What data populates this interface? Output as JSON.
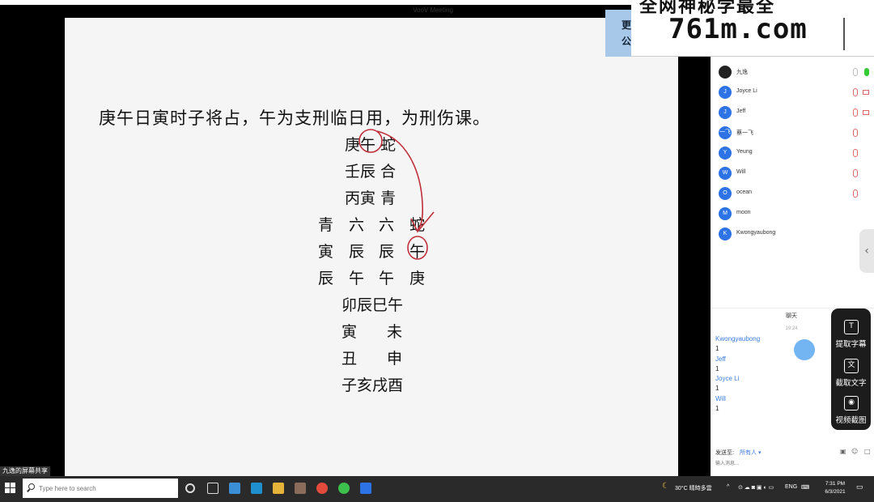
{
  "window": {
    "title": "VooV Meeting"
  },
  "slide": {
    "title": "庚午日寅时子将占，午为支刑临日用，为刑伤课。",
    "stem_rows": [
      "庚午 蛇",
      "壬辰 合",
      "丙寅 青"
    ],
    "grid": [
      [
        "青",
        "六",
        "六",
        "蛇"
      ],
      [
        "寅",
        "辰",
        "辰",
        "午"
      ],
      [
        "辰",
        "午",
        "午",
        "庚"
      ]
    ],
    "heaven_plate": {
      "top": "卯辰巳午",
      "row2_left": "寅",
      "row2_right": "未",
      "row3_left": "丑",
      "row3_right": "申",
      "bottom": "子亥戌酉"
    }
  },
  "watermark": {
    "top": "全网神秘学最全",
    "main": "761m.com"
  },
  "blue_panel": {
    "line1": "更",
    "line2": "公"
  },
  "participants": [
    {
      "initial": "",
      "name": "九逸",
      "dark": true
    },
    {
      "initial": "J",
      "name": "Joyce Li"
    },
    {
      "initial": "J",
      "name": "Jeff"
    },
    {
      "initial": "一飞",
      "name": "蔡一飞"
    },
    {
      "initial": "Y",
      "name": "Yeung"
    },
    {
      "initial": "W",
      "name": "Will"
    },
    {
      "initial": "O",
      "name": "ocean"
    },
    {
      "initial": "M",
      "name": "moon"
    },
    {
      "initial": "K",
      "name": "Kwongyaubong"
    }
  ],
  "chat": {
    "title": "聊天",
    "time": "19:24",
    "messages": [
      {
        "name": "Kwongyaubong",
        "text": "1"
      },
      {
        "name": "Jeff",
        "text": "1"
      },
      {
        "name": "Joyce Li",
        "text": "1"
      },
      {
        "name": "Will",
        "text": "1"
      }
    ],
    "send_to_label": "发送至:",
    "send_to_value": "所有人 ▾",
    "input_placeholder": "输入消息..."
  },
  "tools": [
    {
      "icon": "T",
      "label": "提取字幕"
    },
    {
      "icon": "文",
      "label": "截取文字"
    },
    {
      "icon": "◉",
      "label": "视频截图"
    }
  ],
  "share_label": "九逸的屏幕共享",
  "taskbar": {
    "search_placeholder": "Type here to search",
    "weather": "30°C 晴時多雲",
    "lang": "ENG",
    "time": "7:31 PM",
    "date": "6/3/2021"
  },
  "colors": {
    "accent": "#2d73e6",
    "ink": "#c0303a"
  }
}
